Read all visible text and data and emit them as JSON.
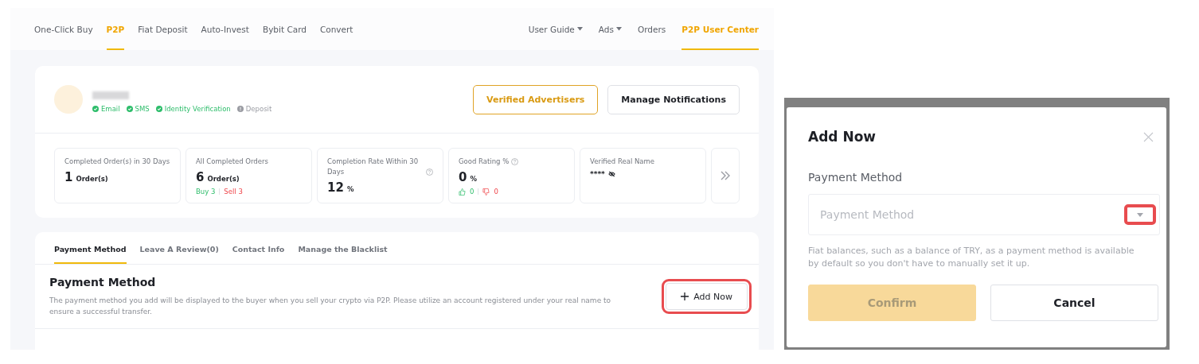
{
  "nav": {
    "left": [
      {
        "label": "One-Click Buy",
        "selected": false
      },
      {
        "label": "P2P",
        "selected": true
      },
      {
        "label": "Fiat Deposit",
        "selected": false
      },
      {
        "label": "Auto-Invest",
        "selected": false
      },
      {
        "label": "Bybit Card",
        "selected": false
      },
      {
        "label": "Convert",
        "selected": false
      }
    ],
    "right": [
      {
        "label": "User Guide",
        "dropdown": true,
        "selected": false
      },
      {
        "label": "Ads",
        "dropdown": true,
        "selected": false
      },
      {
        "label": "Orders",
        "dropdown": false,
        "selected": false
      },
      {
        "label": "P2P User Center",
        "dropdown": false,
        "selected": true
      }
    ]
  },
  "profile": {
    "verifications": [
      {
        "label": "Email",
        "verified": true
      },
      {
        "label": "SMS",
        "verified": true
      },
      {
        "label": "Identity Verification",
        "verified": true
      },
      {
        "label": "Deposit",
        "verified": false
      }
    ],
    "buttons": [
      {
        "label": "Verified Advertisers",
        "kind": "primary"
      },
      {
        "label": "Manage Notifications",
        "kind": "default"
      }
    ]
  },
  "stats": [
    {
      "label": "Completed Order(s) in 30 Days",
      "help": false,
      "value": "1",
      "unit": "Order(s)"
    },
    {
      "label": "All Completed Orders",
      "help": false,
      "value": "6",
      "unit": "Order(s)",
      "buy": "Buy 3",
      "sell": "Sell 3"
    },
    {
      "label": "Completion Rate Within 30 Days",
      "help": true,
      "value": "12",
      "unit": "%"
    },
    {
      "label": "Good Rating %",
      "help": true,
      "value": "0",
      "unit": "%",
      "likes": "0",
      "dislikes": "0"
    },
    {
      "label": "Verified Real Name",
      "help": false,
      "masked": "****"
    }
  ],
  "tabs": [
    {
      "label": "Payment Method",
      "selected": true
    },
    {
      "label": "Leave A Review(0)",
      "selected": false
    },
    {
      "label": "Contact Info",
      "selected": false
    },
    {
      "label": "Manage the Blacklist",
      "selected": false
    }
  ],
  "payment": {
    "title": "Payment Method",
    "description": "The payment method you add will be displayed to the buyer when you sell your crypto via P2P. Please utilize an account registered under your real name to ensure a successful transfer.",
    "add_button": {
      "label": "Add Now",
      "highlighted": true
    }
  },
  "modal": {
    "title": "Add Now",
    "field_label": "Payment Method",
    "placeholder": "Payment Method",
    "arrow_highlighted": true,
    "note": "Fiat balances, such as a balance of TRY, as a payment method is available by default so you don't have to manually set it up.",
    "confirm": {
      "label": "Confirm",
      "disabled": true
    },
    "cancel": {
      "label": "Cancel"
    }
  }
}
